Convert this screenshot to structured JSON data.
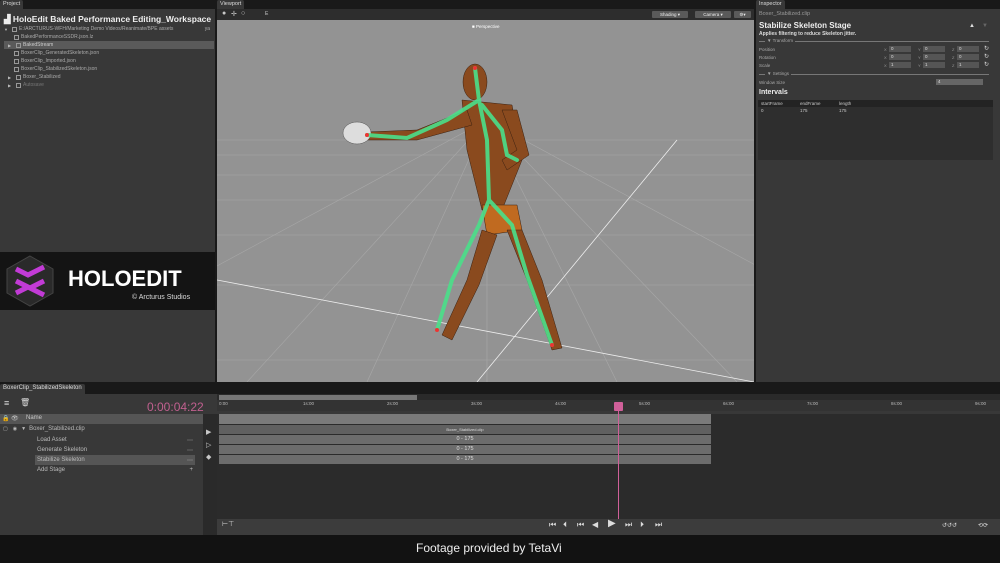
{
  "project": {
    "tab": "Project",
    "title": "HoloEdit Baked Performance Editing_Workspace",
    "tree": [
      {
        "label": "E:/ARCTURUS-WFH/Marketing Demo Videos/Reanimate/BPE assets",
        "suffix": "ya"
      },
      {
        "label": "BakedPerformanceSSDR.json.lz"
      },
      {
        "label": "BakedStream",
        "selected": true
      },
      {
        "label": "BoxerClip_GeneratedSkeleton.json"
      },
      {
        "label": "BoxerClip_Imported.json"
      },
      {
        "label": "BoxerClip_StabilizedSkeleton.json"
      },
      {
        "label": "Boxer_Stabilized"
      },
      {
        "label": "Autosave"
      }
    ]
  },
  "logo": {
    "text": "HOLOEDIT",
    "sub": "© Arcturus Studios",
    "accent": "#c23bd6"
  },
  "viewport": {
    "tab": "Viewport",
    "mode_label": "E",
    "shading": "Shading",
    "camera": "Camera",
    "perspective": "Perspective",
    "background": "#939393"
  },
  "inspector": {
    "tab": "Inspector",
    "clip": "Boxer_Stabilized.clip",
    "stage_title": "Stabilize Skeleton Stage",
    "description": "Applies filtering to reduce Skeleton jitter.",
    "transform_label": "Transform",
    "rows": [
      {
        "label": "Position",
        "x": "0",
        "y": "0",
        "z": "0"
      },
      {
        "label": "Rotation",
        "x": "0",
        "y": "0",
        "z": "0"
      },
      {
        "label": "Scale",
        "x": "1",
        "y": "1",
        "z": "1"
      }
    ],
    "settings_label": "Settings",
    "window_size_label": "Window Size",
    "window_size": "4",
    "intervals_title": "Intervals",
    "interval_headers": [
      "startFrame",
      "endFrame",
      "length"
    ],
    "interval_rows": [
      [
        "0",
        "175",
        "175"
      ]
    ]
  },
  "timeline": {
    "tab": "BoxerClip_StabilizedSkeleton",
    "time": "0:00:04:22",
    "name_header": "Name",
    "clip": "Boxer_Stabilized.clip",
    "stages": [
      "Load Asset",
      "Generate Skeleton",
      "Stabilize Skeleton"
    ],
    "add_stage": "Add Stage",
    "ruler": [
      "0:00",
      "1s:00",
      "2s:00",
      "3s:00",
      "4s:00",
      "5s:00",
      "6s:00",
      "7s:00",
      "8s:00",
      "9s:00"
    ],
    "clip_bar_label": "Boxer_Stabilized.clip",
    "ranges": [
      "0 - 175",
      "0 - 175",
      "0 - 175"
    ],
    "accent": "#d0609a"
  },
  "caption": "Footage provided by TetaVi"
}
